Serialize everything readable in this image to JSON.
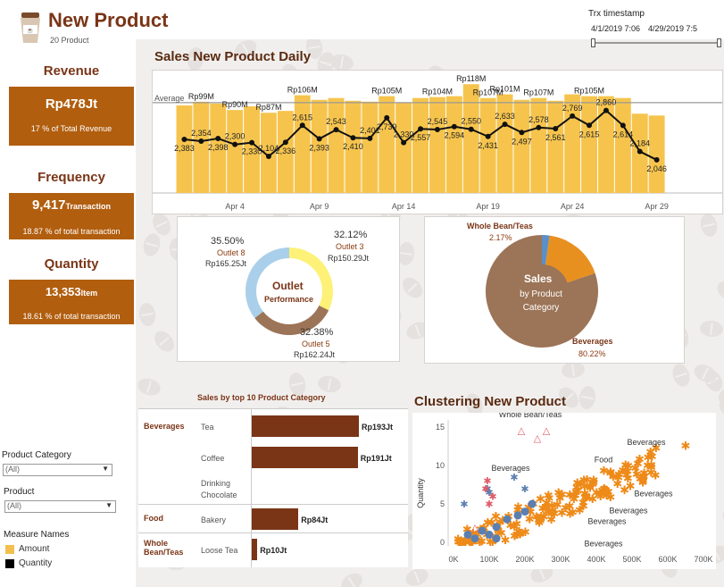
{
  "header": {
    "title": "New Product",
    "subtitle": "20 Product"
  },
  "timestamp": {
    "label": "Trx timestamp",
    "start": "4/1/2019 7:06",
    "end": "4/29/2019 7:5"
  },
  "kpis": {
    "revenue": {
      "title": "Revenue",
      "value": "Rp478Jt",
      "sub": "17 % of Total Revenue"
    },
    "frequency": {
      "title": "Frequency",
      "value": "9,417",
      "unit": "Transaction",
      "sub": "18.87 % of total transaction"
    },
    "quantity": {
      "title": "Quantity",
      "value": "13,353",
      "unit": "Item",
      "sub": "18.61 % of total transaction"
    }
  },
  "filters": {
    "category_label": "Product Category",
    "category_value": "(All)",
    "product_label": "Product",
    "product_value": "(All)",
    "measure_label": "Measure Names",
    "amount_label": "Amount",
    "quantity_label": "Quantity",
    "amount_color": "#f2c04d",
    "quantity_color": "#000000"
  },
  "daily": {
    "title": "Sales New Product Daily",
    "average_label": "Average",
    "x_ticks": [
      "Apr 4",
      "Apr 9",
      "Apr 14",
      "Apr 19",
      "Apr 24",
      "Apr 29"
    ],
    "bar_labels": [
      "",
      "Rp99M",
      "Rp90M",
      "Rp87M",
      "",
      "Rp106M",
      "",
      "",
      "Rp105M",
      "Rp104M",
      "Rp118M",
      "Rp107M",
      "Rp101M",
      "",
      "Rp107M",
      "Rp105M"
    ],
    "qty_labels": [
      "2,383",
      "2,354",
      "2,398",
      "2,300",
      "2,330",
      "2,104",
      "2,336",
      "2,615",
      "2,393",
      "2,543",
      "2,410",
      "2,401",
      "2,739",
      "2,330",
      "2,557",
      "2,545",
      "2,594",
      "2,550",
      "2,431",
      "2,633",
      "2,497",
      "2,578",
      "2,561",
      "2,769",
      "2,615",
      "2,860",
      "2,614",
      "2,184",
      "2,046"
    ]
  },
  "outlet": {
    "center_title": "Outlet",
    "center_sub": "Performance",
    "slices": [
      {
        "pct": "35.50%",
        "name": "Outlet 8",
        "value": "Rp165.25Jt",
        "share": 35.5,
        "color": "#aacfea"
      },
      {
        "pct": "32.12%",
        "name": "Outlet 3",
        "value": "Rp150.29Jt",
        "share": 32.12,
        "color": "#fdf178"
      },
      {
        "pct": "32.38%",
        "name": "Outlet 5",
        "value": "Rp162.24Jt",
        "share": 32.38,
        "color": "#9c7457"
      }
    ]
  },
  "category_pie": {
    "center_title": "Sales",
    "center_sub": "by Product Category",
    "slices": [
      {
        "name": "Whole Bean/Teas",
        "pct": "2.17%",
        "share": 2.17,
        "color": "#5b8fc7"
      },
      {
        "name": "Food",
        "pct": "",
        "share": 17.61,
        "color": "#e8901f"
      },
      {
        "name": "Beverages",
        "pct": "80.22%",
        "share": 80.22,
        "color": "#9c7457"
      }
    ]
  },
  "top10": {
    "title": "Sales by top 10 Product Category",
    "groups": [
      {
        "group": "Beverages",
        "items": [
          {
            "name": "Tea",
            "value": "Rp193Jt",
            "amount": 193
          },
          {
            "name": "Coffee",
            "value": "Rp191Jt",
            "amount": 191
          },
          {
            "name": "Drinking Chocolate",
            "value": "",
            "amount": 0
          }
        ]
      },
      {
        "group": "Food",
        "items": [
          {
            "name": "Bakery",
            "value": "Rp84Jt",
            "amount": 84
          }
        ]
      },
      {
        "group": "Whole Bean/Teas",
        "items": [
          {
            "name": "Loose Tea",
            "value": "Rp10Jt",
            "amount": 10
          }
        ]
      }
    ]
  },
  "cluster": {
    "title": "Clustering New Product",
    "ylabel": "Quantity",
    "x_ticks": [
      "0K",
      "100K",
      "200K",
      "300K",
      "400K",
      "500K",
      "600K",
      "700K"
    ],
    "y_ticks": [
      "0",
      "5",
      "10",
      "15"
    ],
    "annotations": [
      "Whole Bean/Teas",
      "Beverages",
      "Food",
      "Beverages",
      "Beverages",
      "Beverages",
      "Beverages",
      "Beverages"
    ]
  },
  "chart_data": {
    "type": "bar",
    "title": "Sales New Product Daily",
    "categories": [
      "Apr 1",
      "Apr 2",
      "Apr 3",
      "Apr 4",
      "Apr 5",
      "Apr 6",
      "Apr 7",
      "Apr 8",
      "Apr 9",
      "Apr 10",
      "Apr 11",
      "Apr 12",
      "Apr 13",
      "Apr 14",
      "Apr 15",
      "Apr 16",
      "Apr 17",
      "Apr 18",
      "Apr 19",
      "Apr 20",
      "Apr 21",
      "Apr 22",
      "Apr 23",
      "Apr 24",
      "Apr 25",
      "Apr 26",
      "Apr 27",
      "Apr 28",
      "Apr 29"
    ],
    "series": [
      {
        "name": "Amount",
        "values": [
          95,
          99,
          97,
          90,
          94,
          87,
          89,
          106,
          101,
          103,
          100,
          99,
          105,
          98,
          103,
          104,
          105,
          118,
          103,
          107,
          101,
          103,
          100,
          107,
          105,
          105,
          103,
          86,
          84
        ]
      },
      {
        "name": "Quantity",
        "values": [
          2383,
          2354,
          2398,
          2300,
          2330,
          2104,
          2336,
          2615,
          2393,
          2543,
          2410,
          2401,
          2739,
          2330,
          2557,
          2545,
          2594,
          2550,
          2431,
          2633,
          2497,
          2578,
          2561,
          2769,
          2615,
          2860,
          2614,
          2184,
          2046
        ]
      }
    ]
  }
}
